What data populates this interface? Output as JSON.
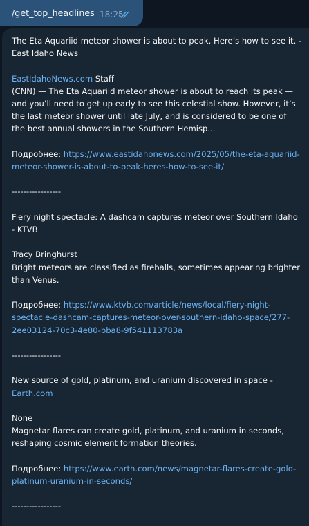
{
  "sent_message": {
    "text": "/get_top_headlines",
    "time": "18:25"
  },
  "reply": {
    "articles": [
      {
        "title": "The Eta Aquariid meteor shower is about to peak. Here’s how to see it. - East Idaho News",
        "author_link": "EastIdahoNews.com",
        "author_rest": " Staff",
        "summary": "(CNN) — The Eta Aquariid meteor shower is about to reach its peak — and you’ll need to get up early to see this celestial show. However, it’s the last meteor shower until late July, and is considered to be one of the best annual showers in the Southern Hemisp...",
        "more_label": "Подробнее: ",
        "url": "https://www.eastidahonews.com/2025/05/the-eta-aquariid-meteor-shower-is-about-to-peak-heres-how-to-see-it/"
      },
      {
        "title": "Fiery night spectacle: A dashcam captures meteor over Southern Idaho - KTVB",
        "author": "Tracy Bringhurst",
        "summary": "Bright meteors are classified as fireballs, sometimes appearing brighter than Venus.",
        "more_label": "Подробнее: ",
        "url": "https://www.ktvb.com/article/news/local/fiery-night-spectacle-dashcam-captures-meteor-over-southern-idaho-space/277-2ee03124-70c3-4e80-bba8-9f541113783a"
      },
      {
        "title_text": "New source of gold, platinum, and uranium discovered in space - ",
        "title_link": "Earth.com",
        "author": "None",
        "summary": "Magnetar flares can create gold, platinum, and uranium in seconds, reshaping cosmic element formation theories.",
        "more_label": "Подробнее: ",
        "url": "https://www.earth.com/news/magnetar-flares-create-gold-platinum-uranium-in-seconds/"
      }
    ],
    "separator": "-----------------"
  },
  "colors": {
    "background": "#0e1621",
    "sent_bubble": "#2b5278",
    "received_bubble": "#182533",
    "link": "#6ab2f2",
    "text": "#f5f5f5",
    "time": "#8fa9c3"
  },
  "icons": {
    "read_status": "double-check-icon"
  }
}
